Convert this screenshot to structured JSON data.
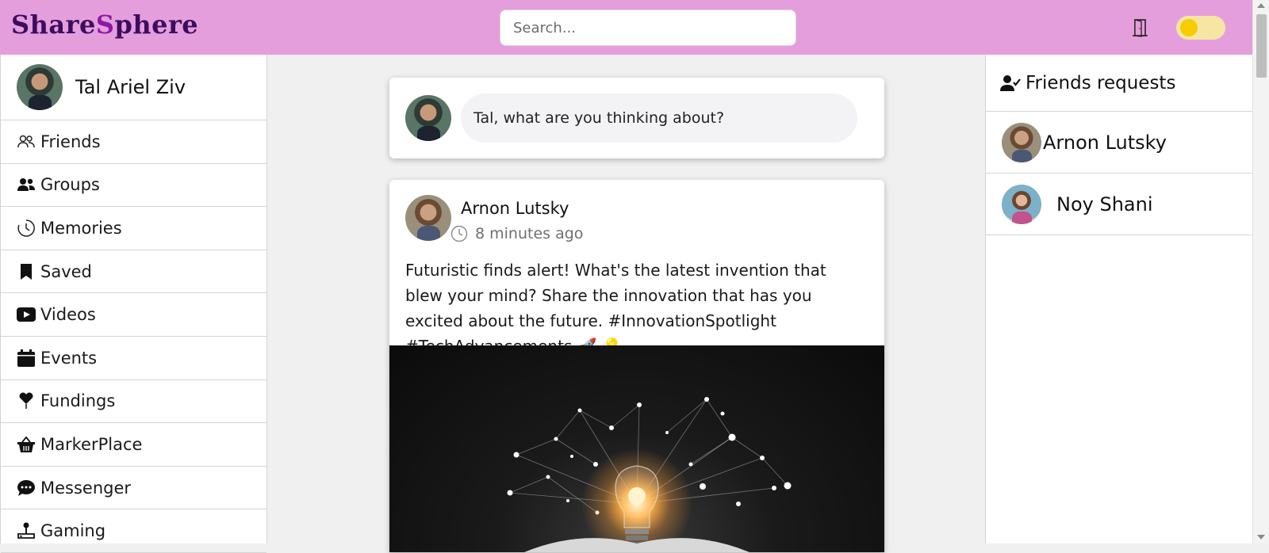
{
  "header": {
    "logo_part1": "Share",
    "logo_part2": "S",
    "logo_part3": "phere",
    "search_placeholder": "Search...",
    "logout_icon": "door-exit-icon",
    "theme_toggle_icon": "theme-toggle",
    "brand_bg": "#e59edc"
  },
  "sidebar": {
    "user_name": "Tal Ariel Ziv",
    "items": [
      {
        "label": "Friends",
        "icon": "friends-icon"
      },
      {
        "label": "Groups",
        "icon": "groups-icon"
      },
      {
        "label": "Memories",
        "icon": "clock-icon"
      },
      {
        "label": "Saved",
        "icon": "bookmark-icon"
      },
      {
        "label": "Videos",
        "icon": "play-icon"
      },
      {
        "label": "Events",
        "icon": "calendar-icon"
      },
      {
        "label": "Fundings",
        "icon": "heart-icon"
      },
      {
        "label": "MarkerPlace",
        "icon": "basket-icon"
      },
      {
        "label": "Messenger",
        "icon": "chat-icon"
      },
      {
        "label": "Gaming",
        "icon": "joystick-icon"
      }
    ]
  },
  "composer": {
    "prompt": "Tal, what are you thinking about?"
  },
  "post": {
    "author": "Arnon Lutsky",
    "time": "8 minutes ago",
    "text": "Futuristic finds alert! What's the latest invention that blew your mind? Share the innovation that has you excited about the future. #InnovationSpotlight #TechAdvancements 🚀 💡",
    "image_desc_icon": "lightbulb-network-image"
  },
  "friend_requests": {
    "title": "Friends requests",
    "items": [
      {
        "name": "Arnon Lutsky"
      },
      {
        "name": "Noy Shani"
      }
    ]
  }
}
